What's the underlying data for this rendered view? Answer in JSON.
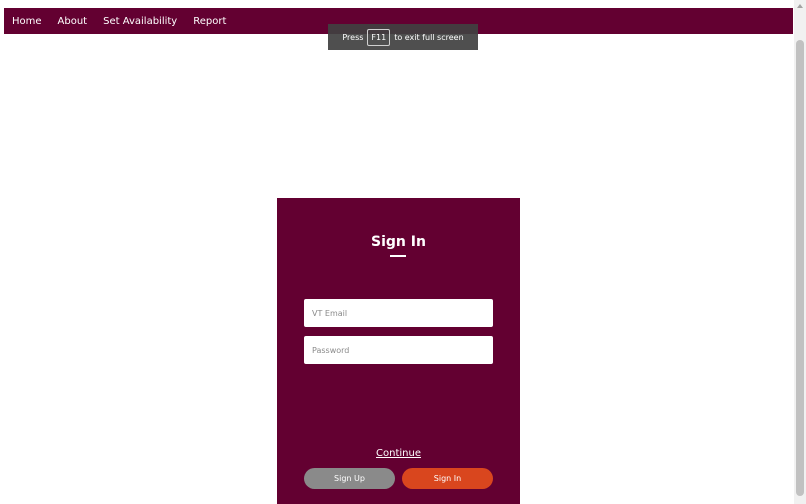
{
  "nav": {
    "items": [
      "Home",
      "About",
      "Set Availability",
      "Report"
    ]
  },
  "fullscreen_notice": {
    "prefix": "Press",
    "key": "F11",
    "suffix": "to exit full screen"
  },
  "signin": {
    "title": "Sign In",
    "email_placeholder": "VT Email",
    "password_placeholder": "Password",
    "continue_label": "Continue",
    "signup_label": "Sign Up",
    "signin_label": "Sign In"
  },
  "colors": {
    "brand": "#630031",
    "signin_button": "#d9461e",
    "signup_button": "#8a8a8a"
  }
}
